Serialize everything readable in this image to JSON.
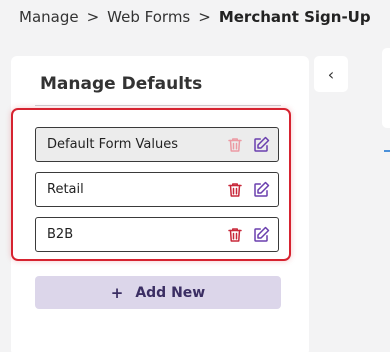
{
  "breadcrumb": {
    "items": [
      "Manage",
      "Web Forms",
      "Merchant Sign-Up"
    ],
    "separator": ">"
  },
  "panel": {
    "title": "Manage Defaults",
    "items": [
      {
        "label": "Default Form Values",
        "state": "default"
      },
      {
        "label": "Retail",
        "state": "normal"
      },
      {
        "label": "B2B",
        "state": "normal"
      }
    ],
    "add_button": {
      "icon": "plus-icon",
      "label": "Add New"
    }
  },
  "collapse_button": {
    "icon": "chevron-left-icon",
    "glyph": "‹"
  },
  "colors": {
    "delete_active": "#c8283a",
    "delete_disabled": "#ec9aa3",
    "edit": "#6a3fae",
    "highlight": "#d62330",
    "add_button_bg": "#dcd6ea"
  }
}
